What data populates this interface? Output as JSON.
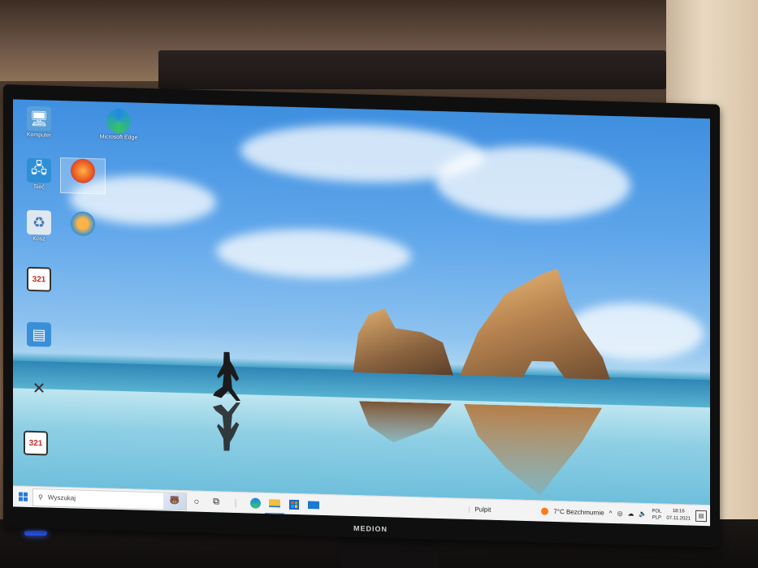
{
  "desktop": {
    "icons": [
      {
        "label": "Komputer",
        "icon": "computer-icon"
      },
      {
        "label": "Microsoft Edge",
        "icon": "edge-icon"
      },
      {
        "label": "Sieć",
        "icon": "network-icon"
      },
      {
        "label": "",
        "icon": "firefox-icon"
      },
      {
        "label": "Kosz",
        "icon": "recycle-bin-icon"
      },
      {
        "label": "",
        "icon": "app-orange-circle-icon"
      },
      {
        "label": "",
        "icon": "media-player-classic-icon"
      },
      {
        "label": "",
        "icon": "control-panel-icon"
      },
      {
        "label": "",
        "icon": "tools-icon"
      },
      {
        "label": "",
        "icon": "media-player-classic-icon"
      }
    ]
  },
  "taskbar": {
    "search_placeholder": "Wyszukaj",
    "desktop_label": "Pulpit",
    "weather": "7°C Bezchmurnie",
    "lang_top": "POL",
    "lang_bottom": "PLP",
    "time": "18:16",
    "date": "07.11.2021",
    "chevron": "^"
  },
  "monitor": {
    "brand": "MEDION"
  }
}
